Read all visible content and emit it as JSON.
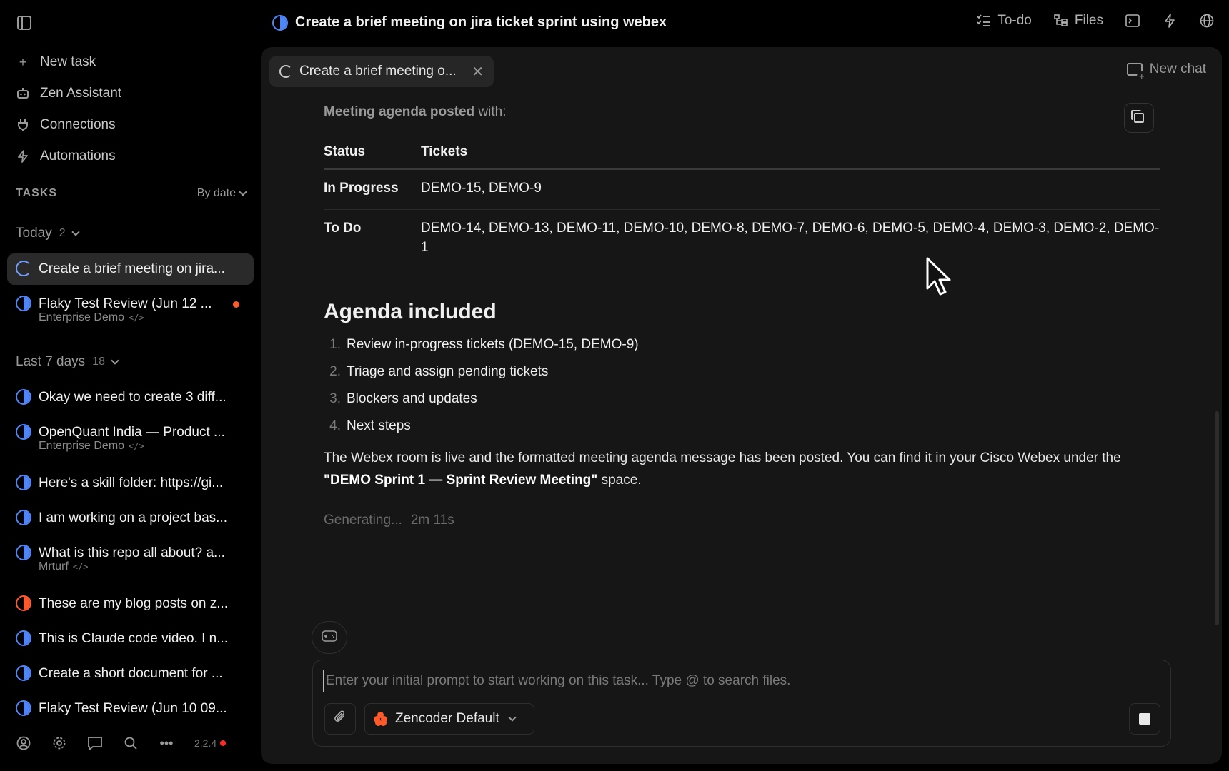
{
  "sidebar": {
    "nav": [
      {
        "label": "New task",
        "icon": "plus-icon"
      },
      {
        "label": "Zen Assistant",
        "icon": "robot-icon"
      },
      {
        "label": "Connections",
        "icon": "plug-icon"
      },
      {
        "label": "Automations",
        "icon": "bolt-icon"
      }
    ],
    "tasks_label": "TASKS",
    "sort_label": "By date",
    "today": {
      "label": "Today",
      "count": "2"
    },
    "last7": {
      "label": "Last 7 days",
      "count": "18"
    },
    "today_tasks": [
      {
        "title": "Create a brief meeting on jira...",
        "status": "running"
      },
      {
        "title": "Flaky Test Review (Jun 12 ...",
        "sub": "Enterprise Demo",
        "status": "half",
        "unread": true
      }
    ],
    "week_tasks": [
      {
        "title": "Okay we need to create 3 diff...",
        "status": "half"
      },
      {
        "title": "OpenQuant India — Product ...",
        "sub": "Enterprise Demo",
        "status": "half"
      },
      {
        "title": "Here's a skill folder: https://gi...",
        "status": "half"
      },
      {
        "title": "I am working on a project bas...",
        "status": "half"
      },
      {
        "title": "What is this repo all about? a...",
        "sub": "Mrturf",
        "status": "half"
      },
      {
        "title": "These are my blog posts on z...",
        "status": "orange"
      },
      {
        "title": "This is Claude code video. I n...",
        "status": "half"
      },
      {
        "title": "Create a short document for ...",
        "status": "half"
      },
      {
        "title": "Flaky Test Review (Jun 10 09...",
        "status": "half"
      }
    ],
    "code_glyph": "</>",
    "version": "2.2.4"
  },
  "topbar": {
    "title": "Create a brief meeting on jira ticket sprint using webex",
    "todo_label": "To-do",
    "files_label": "Files"
  },
  "panel": {
    "tab_label": "Create a brief meeting o...",
    "new_chat_label": "New chat",
    "posted_bold": "Meeting agenda posted",
    "posted_rest": " with:",
    "table": {
      "headers": [
        "Status",
        "Tickets"
      ],
      "rows": [
        {
          "status": "In Progress",
          "tickets": "DEMO-15, DEMO-9"
        },
        {
          "status": "To Do",
          "tickets": "DEMO-14, DEMO-13, DEMO-11, DEMO-10, DEMO-8, DEMO-7, DEMO-6, DEMO-5, DEMO-4, DEMO-3, DEMO-2, DEMO-1"
        }
      ]
    },
    "agenda_heading": "Agenda included",
    "agenda": [
      {
        "num": "1.",
        "text": "Review in-progress tickets (DEMO-15, DEMO-9)"
      },
      {
        "num": "2.",
        "text": "Triage and assign pending tickets"
      },
      {
        "num": "3.",
        "text": "Blockers and updates"
      },
      {
        "num": "4.",
        "text": "Next steps"
      }
    ],
    "para_pre": "The Webex room is live and the formatted meeting agenda message has been posted. You can find it in your Cisco Webex under the ",
    "para_bold": "\"DEMO Sprint 1 — Sprint Review Meeting\"",
    "para_post": " space.",
    "generating": "Generating...",
    "elapsed": "2m 11s",
    "composer_placeholder": "Enter your initial prompt to start working on this task... Type @ to search files.",
    "model_label": "Zencoder Default"
  },
  "colors": {
    "accent_blue": "#4f86f7",
    "accent_orange": "#ff5a2c",
    "panel_bg": "#161616"
  }
}
